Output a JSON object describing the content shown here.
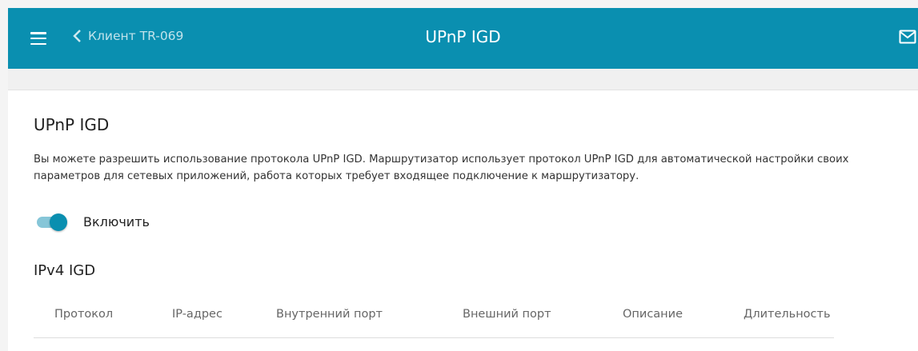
{
  "header": {
    "back_label": "Клиент TR-069",
    "title": "UPnP IGD",
    "accent_color": "#0a8fb0",
    "icons": [
      "menu-icon",
      "chevron-left-icon",
      "mail-icon"
    ]
  },
  "section": {
    "title": "UPnP IGD",
    "description": "Вы можете разрешить использование протокола UPnP IGD. Маршрутизатор использует протокол UPnP IGD для автоматической настройки своих параметров для сетевых приложений, работа которых требует входящее подключение к маршрутизатору.",
    "toggle": {
      "label": "Включить",
      "enabled": true
    }
  },
  "ipv4": {
    "title": "IPv4 IGD",
    "columns": [
      "Протокол",
      "IP-адрес",
      "Внутренний порт",
      "Внешний порт",
      "Описание",
      "Длительность"
    ]
  }
}
